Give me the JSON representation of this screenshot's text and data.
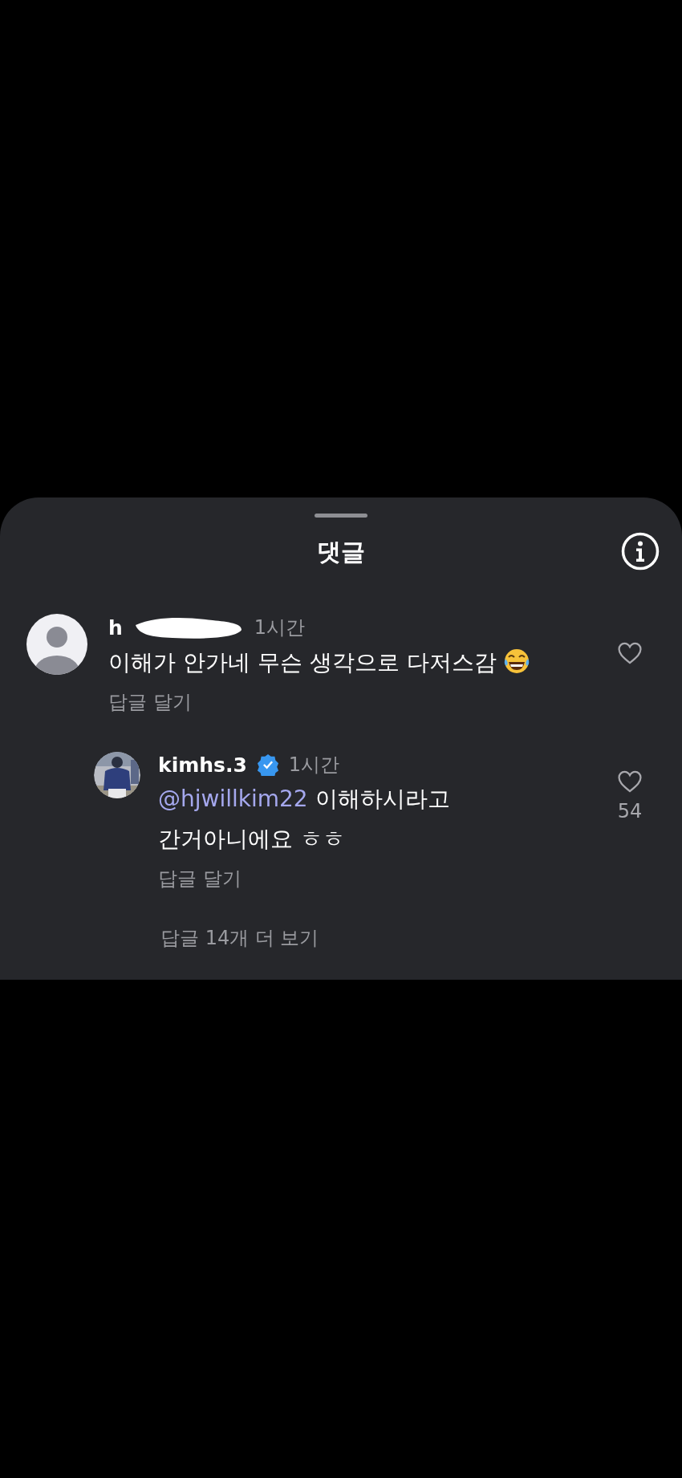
{
  "sheet": {
    "title": "댓글"
  },
  "comment": {
    "username": "h",
    "time": "1시간",
    "text": "이해가 안가네 무슨 생각으로 다저스감",
    "reply_action": "답글 달기",
    "liked": false
  },
  "reply": {
    "username": "kimhs.3",
    "verified": true,
    "time": "1시간",
    "mention": "@hjwillkim22",
    "text_line_1": "이해하시라고",
    "text_line_2": "간거아니에요 ㅎㅎ",
    "reply_action": "답글 달기",
    "liked": false,
    "like_count": "54"
  },
  "more_replies": "답글 14개 더 보기"
}
